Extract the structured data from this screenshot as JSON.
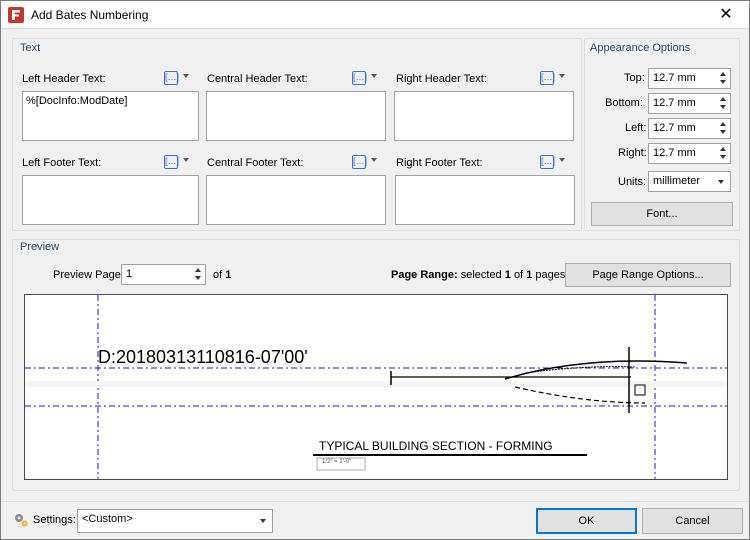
{
  "window": {
    "title": "Add Bates Numbering",
    "close_glyph": "✕"
  },
  "text_group": {
    "title": "Text",
    "left_header": {
      "label": "Left Header Text:",
      "value": "%[DocInfo:ModDate]"
    },
    "central_header": {
      "label": "Central Header Text:",
      "value": ""
    },
    "right_header": {
      "label": "Right Header Text:",
      "value": ""
    },
    "left_footer": {
      "label": "Left Footer Text:",
      "value": ""
    },
    "central_footer": {
      "label": "Central Footer Text:",
      "value": ""
    },
    "right_footer": {
      "label": "Right Footer Text:",
      "value": ""
    },
    "macro_glyph": "[…]"
  },
  "appearance": {
    "title": "Appearance Options",
    "top": {
      "label": "Top:",
      "value": "12.7 mm"
    },
    "bottom": {
      "label": "Bottom:",
      "value": "12.7 mm"
    },
    "left": {
      "label": "Left:",
      "value": "12.7 mm"
    },
    "right": {
      "label": "Right:",
      "value": "12.7 mm"
    },
    "units": {
      "label": "Units:",
      "value": "millimeter"
    },
    "font_button": "Font..."
  },
  "preview": {
    "title": "Preview",
    "page_label": "Preview Page",
    "page_value": "1",
    "of_text": "of",
    "of_total": "1",
    "range_label": "Page Range:",
    "range_selected_text": "selected",
    "range_selected": "1",
    "range_of": "of",
    "range_total": "1",
    "range_pages": "pages",
    "range_button": "Page Range Options...",
    "stamp_text": "D:20180313110816-07'00'",
    "drawing_title": "TYPICAL BUILDING SECTION - FORMING",
    "drawing_scale": "1/2\" = 1'-0\""
  },
  "footer": {
    "settings_label": "Settings:",
    "settings_value": "<Custom>",
    "ok": "OK",
    "cancel": "Cancel"
  },
  "colors": {
    "group_title": "#2b4a73",
    "guide_line": "#1a1acc",
    "app_icon": "#c0392b",
    "focus": "#0078d7"
  }
}
